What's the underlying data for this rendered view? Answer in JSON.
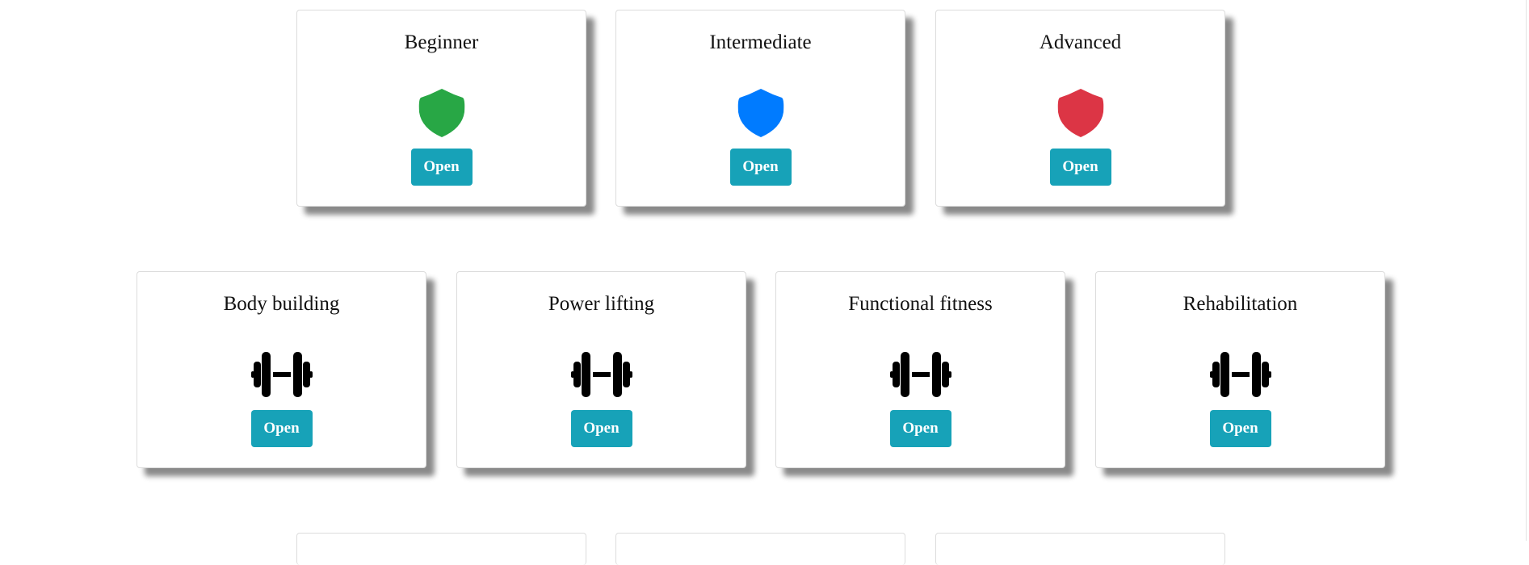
{
  "levels": {
    "cards": [
      {
        "title": "Beginner",
        "icon": "shield-icon",
        "icon_color": "#28a745",
        "button_label": "Open"
      },
      {
        "title": "Intermediate",
        "icon": "shield-icon",
        "icon_color": "#007bff",
        "button_label": "Open"
      },
      {
        "title": "Advanced",
        "icon": "shield-icon",
        "icon_color": "#dc3545",
        "button_label": "Open"
      }
    ]
  },
  "disciplines": {
    "cards": [
      {
        "title": "Body building",
        "icon": "dumbbell-icon",
        "button_label": "Open"
      },
      {
        "title": "Power lifting",
        "icon": "dumbbell-icon",
        "button_label": "Open"
      },
      {
        "title": "Functional fitness",
        "icon": "dumbbell-icon",
        "button_label": "Open"
      },
      {
        "title": "Rehabilitation",
        "icon": "dumbbell-icon",
        "button_label": "Open"
      }
    ]
  },
  "colors": {
    "button_background": "#17a2b8",
    "button_text": "#ffffff"
  }
}
